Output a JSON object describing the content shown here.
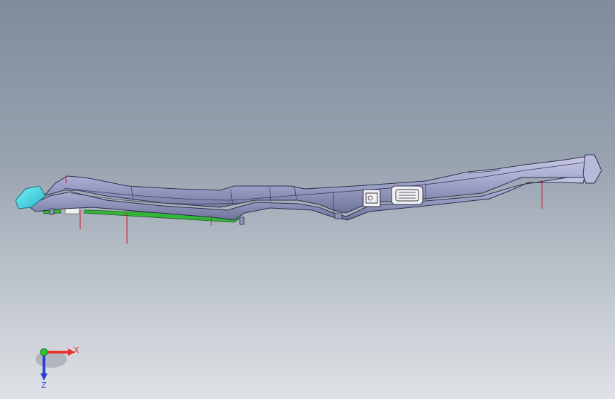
{
  "triad": {
    "x_label": "X",
    "z_label": "Z",
    "x_color": "#e8322c",
    "y_color": "#2fbf3a",
    "z_color": "#2f3fd6"
  },
  "model": {
    "body_color": "#9a9ec4",
    "edge_color": "#2c2f4a",
    "green_part_color": "#33b53a",
    "cyan_part_color": "#3fd8e6",
    "marker_color": "#d2182f"
  }
}
